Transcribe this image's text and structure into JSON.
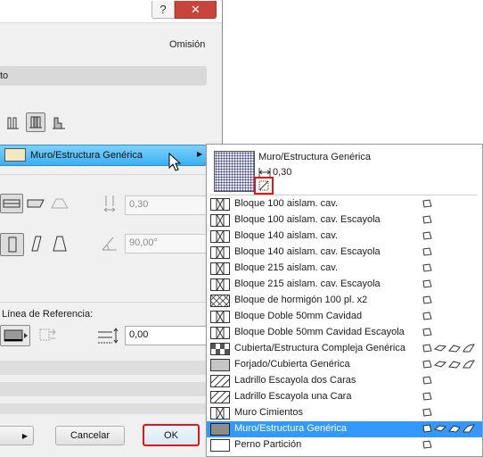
{
  "titlebar": {
    "help_glyph": "?",
    "close_glyph": "✕"
  },
  "dialog": {
    "default_label": "Omisión",
    "section_header": "to",
    "fill_button_label": "Muro/Estructura Genérica",
    "thickness_value": "0,30",
    "angle_value": "90,00°",
    "reference_line_label": "Línea de Referencia:",
    "offset_value": "0,00",
    "cancel_label": "Cancelar",
    "ok_label": "OK"
  },
  "popup": {
    "preview_name": "Muro/Estructura Genérica",
    "preview_thickness": "0,30",
    "items": [
      {
        "label": "Bloque 100 aislam. cav.",
        "pattern": "hatch-box",
        "flags": [
          "wall"
        ]
      },
      {
        "label": "Bloque 100 aislam. cav. Escayola",
        "pattern": "hatch-box",
        "flags": [
          "wall"
        ]
      },
      {
        "label": "Bloque 140 aislam. cav.",
        "pattern": "hatch-box",
        "flags": [
          "wall"
        ]
      },
      {
        "label": "Bloque 140 aislam. cav. Escayola",
        "pattern": "hatch-box",
        "flags": [
          "wall"
        ]
      },
      {
        "label": "Bloque 215 aislam. cav.",
        "pattern": "hatch-box",
        "flags": [
          "wall"
        ]
      },
      {
        "label": "Bloque 215 aislam. cav. Escayola",
        "pattern": "hatch-box",
        "flags": [
          "wall"
        ]
      },
      {
        "label": "Bloque de hormigón 100 pl. x2",
        "pattern": "cross",
        "flags": [
          "wall"
        ]
      },
      {
        "label": "Bloque Doble 50mm Cavidad",
        "pattern": "hatch-box",
        "flags": [
          "wall"
        ]
      },
      {
        "label": "Bloque Doble 50mm Cavidad Escayola",
        "pattern": "hatch-box",
        "flags": [
          "wall"
        ]
      },
      {
        "label": "Cubierta/Estructura Compleja Genérica",
        "pattern": "checker",
        "flags": [
          "wall",
          "slab",
          "roof",
          "shell"
        ]
      },
      {
        "label": "Forjado/Cubierta Genérica",
        "pattern": "dots",
        "flags": [
          "wall",
          "slab",
          "roof",
          "shell"
        ]
      },
      {
        "label": "Ladrillo Escayola dos Caras",
        "pattern": "diag",
        "flags": [
          "wall"
        ]
      },
      {
        "label": "Ladrillo Escayola una Cara",
        "pattern": "diag",
        "flags": [
          "wall"
        ]
      },
      {
        "label": "Muro Cimientos",
        "pattern": "hatch-box",
        "flags": [
          "wall"
        ]
      },
      {
        "label": "Muro/Estructura Genérica",
        "pattern": "dense",
        "flags": [
          "wall",
          "slab",
          "roof",
          "shell"
        ],
        "selected": true
      },
      {
        "label": "Perno Partición",
        "pattern": "blank",
        "flags": [
          "wall"
        ]
      }
    ]
  },
  "colors": {
    "selection": "#3399ff",
    "highlight_border": "#e0161b",
    "close_button": "#c7453a"
  }
}
